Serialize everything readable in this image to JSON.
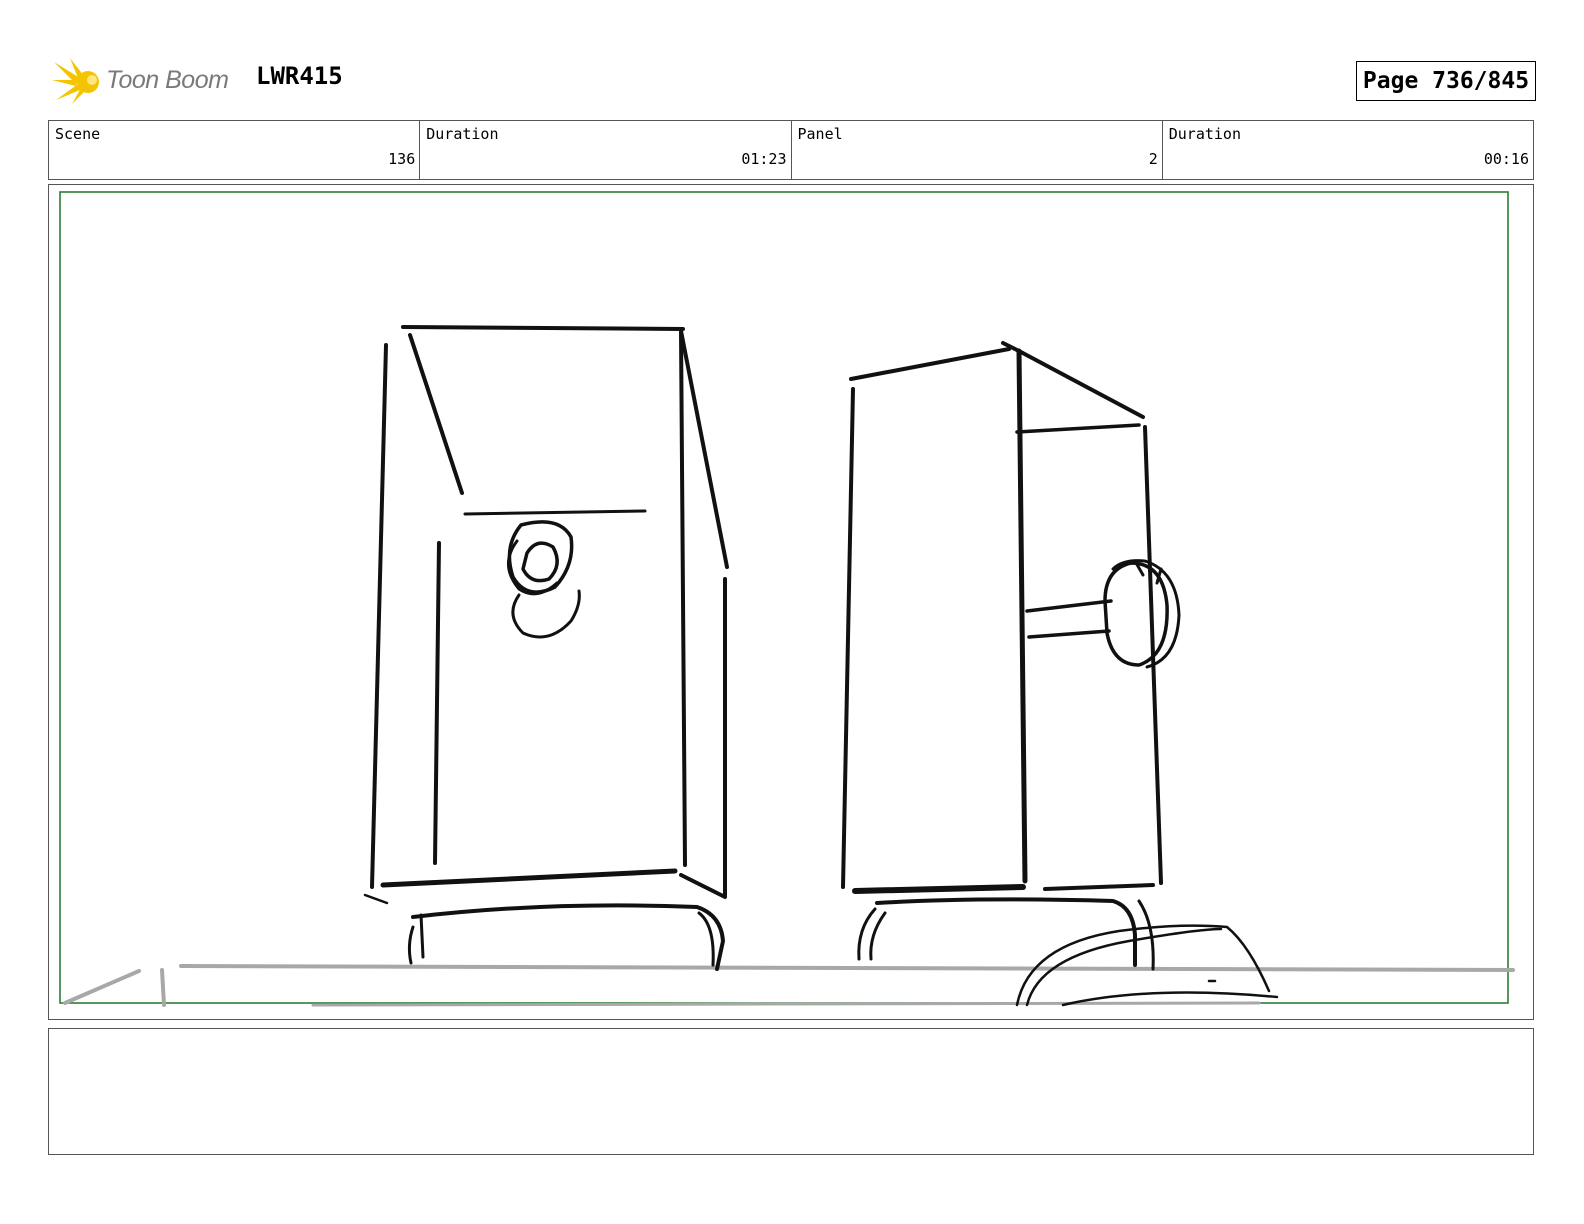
{
  "header": {
    "logo_text": "Toon Boom",
    "project_code": "LWR415",
    "page_label": "Page 736/845"
  },
  "info": {
    "scene_label": "Scene",
    "scene_value": "136",
    "scene_duration_label": "Duration",
    "scene_duration_value": "01:23",
    "panel_label": "Panel",
    "panel_value": "2",
    "panel_duration_label": "Duration",
    "panel_duration_value": "00:16"
  },
  "colors": {
    "safe_frame": "#2e7d32",
    "logo_accent": "#f5c400",
    "sketch_line": "#111111",
    "ground_line": "#a8a8a8"
  },
  "notes": {
    "text": ""
  }
}
